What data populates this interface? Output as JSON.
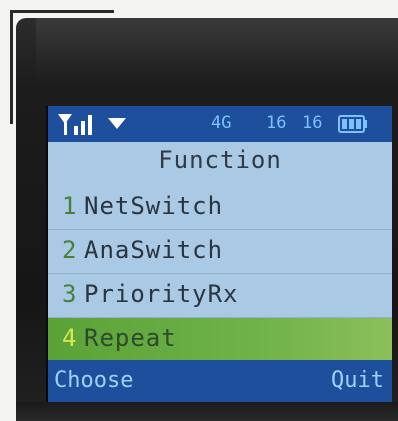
{
  "status_bar": {
    "network_type": "4G",
    "time_hour": "16",
    "time_minute": "16",
    "signal_icon": "signal-strength-icon",
    "dropdown_icon": "dropdown-arrow-icon",
    "battery_icon": "battery-icon"
  },
  "menu": {
    "title": "Function",
    "items": [
      {
        "number": "1",
        "label": "NetSwitch"
      },
      {
        "number": "2",
        "label": "AnaSwitch"
      },
      {
        "number": "3",
        "label": "PriorityRx"
      },
      {
        "number": "4",
        "label": "Repeat"
      }
    ],
    "selected_index": 3
  },
  "softkeys": {
    "left": "Choose",
    "right": "Quit"
  },
  "colors": {
    "status_bar_bg": "#1d4f9c",
    "screen_bg": "#a9c9e4",
    "selection_bg": "#5aa238"
  }
}
